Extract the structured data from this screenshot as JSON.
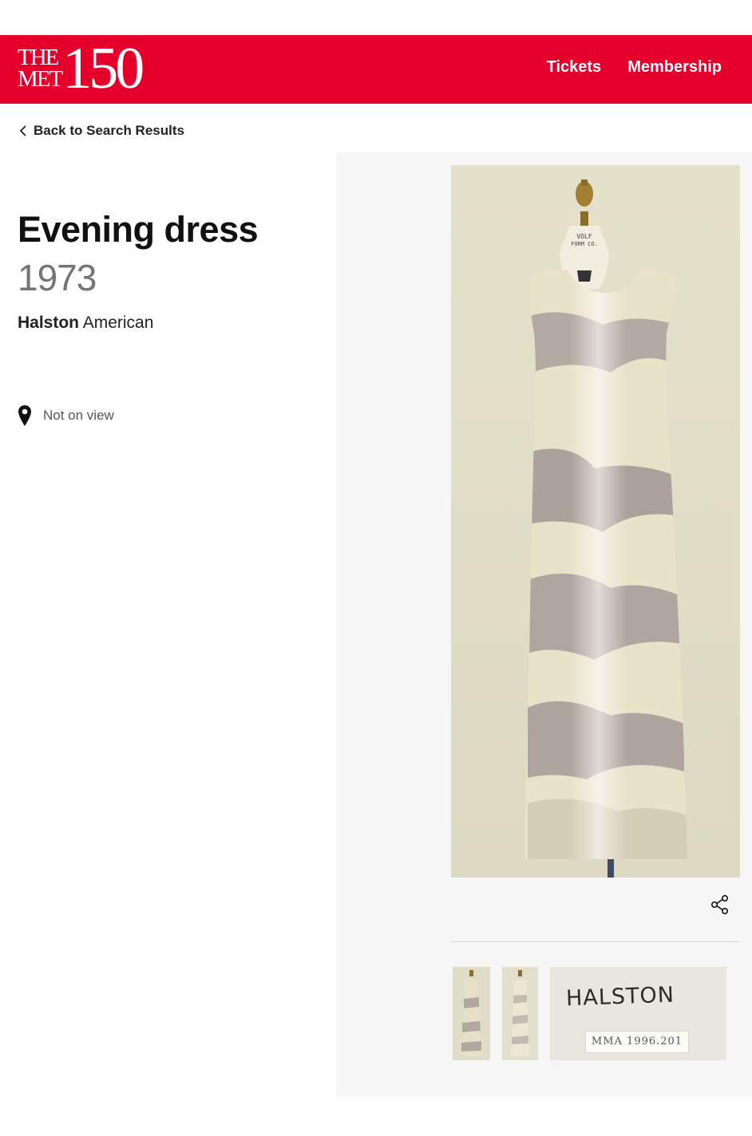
{
  "header": {
    "logo": {
      "line1": "THE",
      "line2": "MET",
      "number": "150"
    },
    "nav": {
      "tickets": "Tickets",
      "membership": "Membership"
    },
    "colors": {
      "brand": "#e4002b"
    }
  },
  "back_link": {
    "label": "Back to Search Results",
    "icon": "chevron-left-icon"
  },
  "object": {
    "title": "Evening dress",
    "date": "1973",
    "artist_name": "Halston",
    "artist_nationality": "American",
    "view_status": "Not on view",
    "view_icon": "map-pin-icon"
  },
  "gallery": {
    "share_icon": "share-icon",
    "form_label": [
      "VOLF",
      "FORM CO."
    ],
    "label_text": "HALSTON",
    "tag_text": "MMA 1996.201"
  }
}
